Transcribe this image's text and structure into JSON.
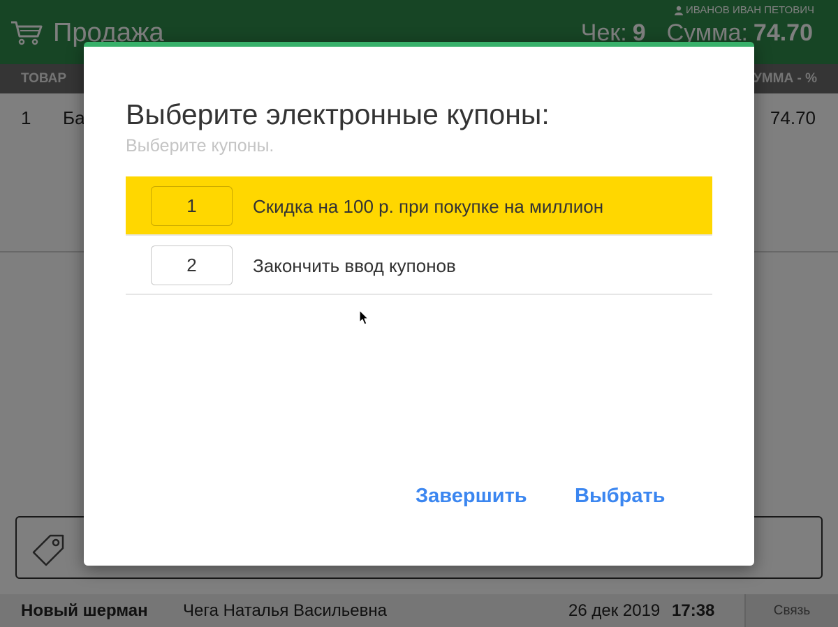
{
  "header": {
    "title": "Продажа",
    "user": "ИВАНОВ ИВАН ПЕТОВИЧ",
    "check_label": "Чек:",
    "check_number": "9",
    "sum_label": "Сумма:",
    "sum_value": "74.70"
  },
  "table": {
    "col_item": "ТОВАР",
    "col_sum": "СУММА - %",
    "rows": [
      {
        "num": "1",
        "name": "Ба",
        "sum": "74.70"
      }
    ]
  },
  "modal": {
    "title": "Выберите электронные купоны:",
    "subtitle": "Выберите купоны.",
    "items": [
      {
        "num": "1",
        "label": "Скидка на 100 р. при покупке на миллион",
        "selected": true
      },
      {
        "num": "2",
        "label": "Закончить ввод купонов",
        "selected": false
      }
    ],
    "finish_label": "Завершить",
    "select_label": "Выбрать"
  },
  "statusbar": {
    "store": "Новый шерман",
    "cashier": "Чега Наталья Васильевна",
    "date": "26 дек 2019",
    "time": "17:38",
    "link": "Связь"
  },
  "colors": {
    "header_green": "#2e8b4a",
    "modal_accent": "#38b06a",
    "selected_row": "#ffd700",
    "action_blue": "#3b86f0"
  },
  "icons": [
    "cart-icon",
    "user-icon",
    "tag-icon",
    "mouse-cursor-icon"
  ]
}
